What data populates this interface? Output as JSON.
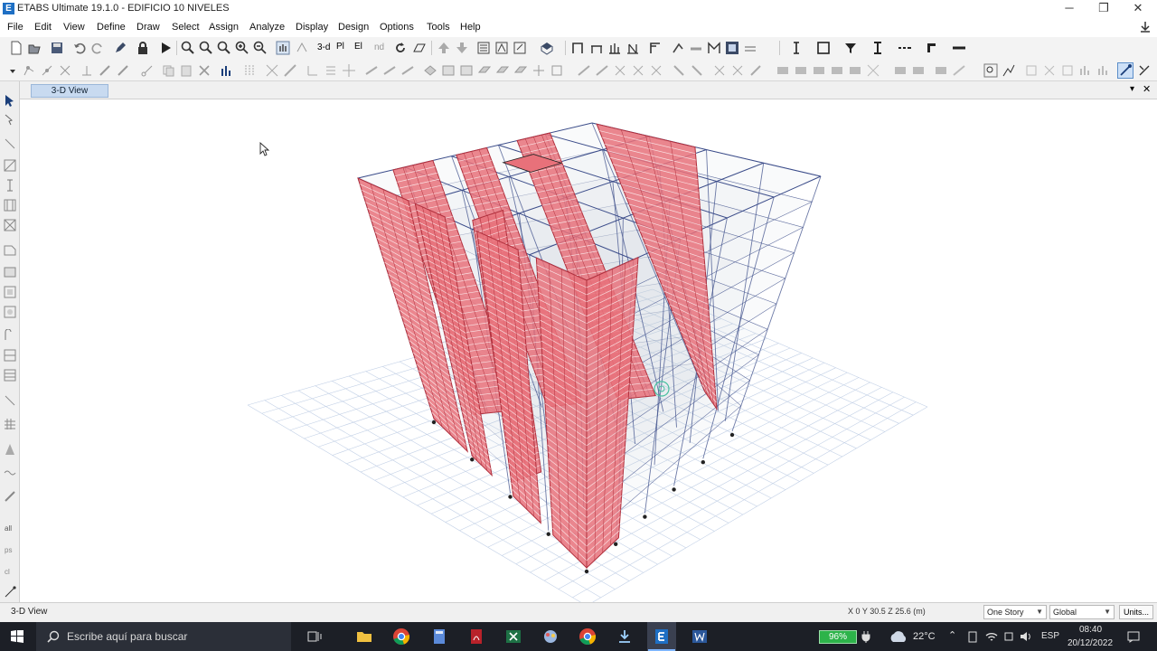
{
  "window": {
    "title": "ETABS Ultimate 19.1.0 - EDIFICIO 10 NIVELES",
    "app_icon_letter": "E",
    "minimize": "─",
    "restore": "❐",
    "close": "✕"
  },
  "menu": [
    "File",
    "Edit",
    "View",
    "Define",
    "Draw",
    "Select",
    "Assign",
    "Analyze",
    "Display",
    "Design",
    "Options",
    "Tools",
    "Help"
  ],
  "toolbar": {
    "view_3d_label": "3-d",
    "plan_label": "Pl",
    "elev_label": "El",
    "nd_label": "nd"
  },
  "view_tab": {
    "label": "3-D View",
    "close": "✕",
    "dropdown": "▾"
  },
  "status": {
    "left_text": "3-D View",
    "coords": "X 0  Y 30.5  Z 25.6 (m)",
    "story_select": "One Story",
    "coord_system_select": "Global",
    "units_button": "Units..."
  },
  "taskbar": {
    "search_placeholder": "Escribe aquí para buscar",
    "battery": "96%",
    "weather": "22°C",
    "language": "ESP",
    "time": "08:40",
    "date": "20/12/2022"
  },
  "colors": {
    "wall_fill": "#e8717a",
    "wall_stroke": "#b1303d",
    "slab_fill": "#b8c4d4",
    "frame_line": "#3c4d8a",
    "grid_line": "#c2d0e6",
    "accent_tab": "#c8daf0"
  }
}
